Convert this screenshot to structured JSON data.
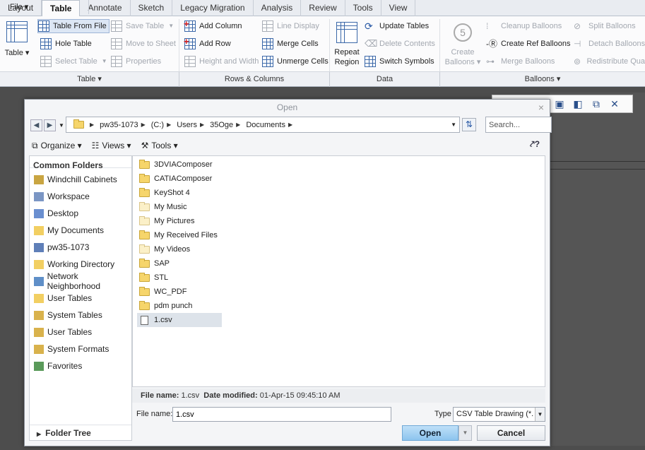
{
  "ribbon": {
    "tabs": [
      {
        "label": "File ▾"
      },
      {
        "label": "Layout"
      },
      {
        "label": "Table"
      },
      {
        "label": "Annotate"
      },
      {
        "label": "Sketch"
      },
      {
        "label": "Legacy Migration"
      },
      {
        "label": "Analysis"
      },
      {
        "label": "Review"
      },
      {
        "label": "Tools"
      },
      {
        "label": "View"
      }
    ],
    "active_tab": "Table",
    "groups": {
      "table": "Table ▾",
      "rows_columns": "Rows & Columns",
      "data": "Data",
      "balloons": "Balloons ▾"
    },
    "buttons": {
      "table_big": "Table ▾",
      "table_from_file": "Table From File",
      "save_table": "Save Table",
      "hole_table": "Hole Table",
      "move_to_sheet": "Move to Sheet",
      "select_table": "Select Table",
      "properties": "Properties",
      "add_column": "Add Column",
      "line_display": "Line Display",
      "add_row": "Add Row",
      "merge_cells": "Merge Cells",
      "height_width": "Height and Width",
      "unmerge_cells": "Unmerge Cells",
      "repeat_region_1": "Repeat",
      "repeat_region_2": "Region",
      "update_tables": "Update Tables",
      "delete_contents": "Delete Contents",
      "switch_symbols": "Switch Symbols",
      "create_balloons_1": "Create",
      "create_balloons_2": "Balloons ▾",
      "cleanup_balloons": "Cleanup Balloons",
      "create_ref_balloons": "Create Ref Balloons",
      "merge_balloons": "Merge Balloons",
      "split_balloons": "Split Balloons",
      "detach_balloons": "Detach Balloons",
      "redistribute": "Redistribute Qua"
    }
  },
  "dialog": {
    "title": "Open",
    "close": "×",
    "breadcrumb": [
      "pw35-1073",
      "(C:)",
      "Users",
      "35Oge",
      "Documents"
    ],
    "search_placeholder": "Search...",
    "toolbar": {
      "organize": "Organize ▾",
      "views": "Views ▾",
      "tools": "Tools ▾"
    },
    "left_title": "Common Folders",
    "common_folders": [
      "Windchill Cabinets",
      "Workspace",
      "Desktop",
      "My Documents",
      "pw35-1073",
      "Working Directory",
      "Network Neighborhood",
      "User Tables",
      "System Tables",
      "User Tables",
      "System Formats",
      "Favorites"
    ],
    "folder_tree": "Folder Tree",
    "files": [
      {
        "name": "3DVIAComposer",
        "kind": "folder"
      },
      {
        "name": "CATIAComposer",
        "kind": "folder"
      },
      {
        "name": "KeyShot 4",
        "kind": "folder"
      },
      {
        "name": "My Music",
        "kind": "folder-light"
      },
      {
        "name": "My Pictures",
        "kind": "folder-light"
      },
      {
        "name": "My Received Files",
        "kind": "folder"
      },
      {
        "name": "My Videos",
        "kind": "folder-light"
      },
      {
        "name": "SAP",
        "kind": "folder"
      },
      {
        "name": "STL",
        "kind": "folder"
      },
      {
        "name": "WC_PDF",
        "kind": "folder"
      },
      {
        "name": "pdm punch",
        "kind": "folder"
      },
      {
        "name": "1.csv",
        "kind": "file",
        "selected": true
      }
    ],
    "info": {
      "name_label": "File name:",
      "name": "1.csv",
      "date_label": "Date modified:",
      "date": "01-Apr-15 09:45:10 AM"
    },
    "file_name_label": "File name:",
    "file_name_value": "1.csv",
    "type_label": "Type",
    "type_value": "CSV Table Drawing (*.",
    "open_button": "Open",
    "cancel_button": "Cancel"
  }
}
